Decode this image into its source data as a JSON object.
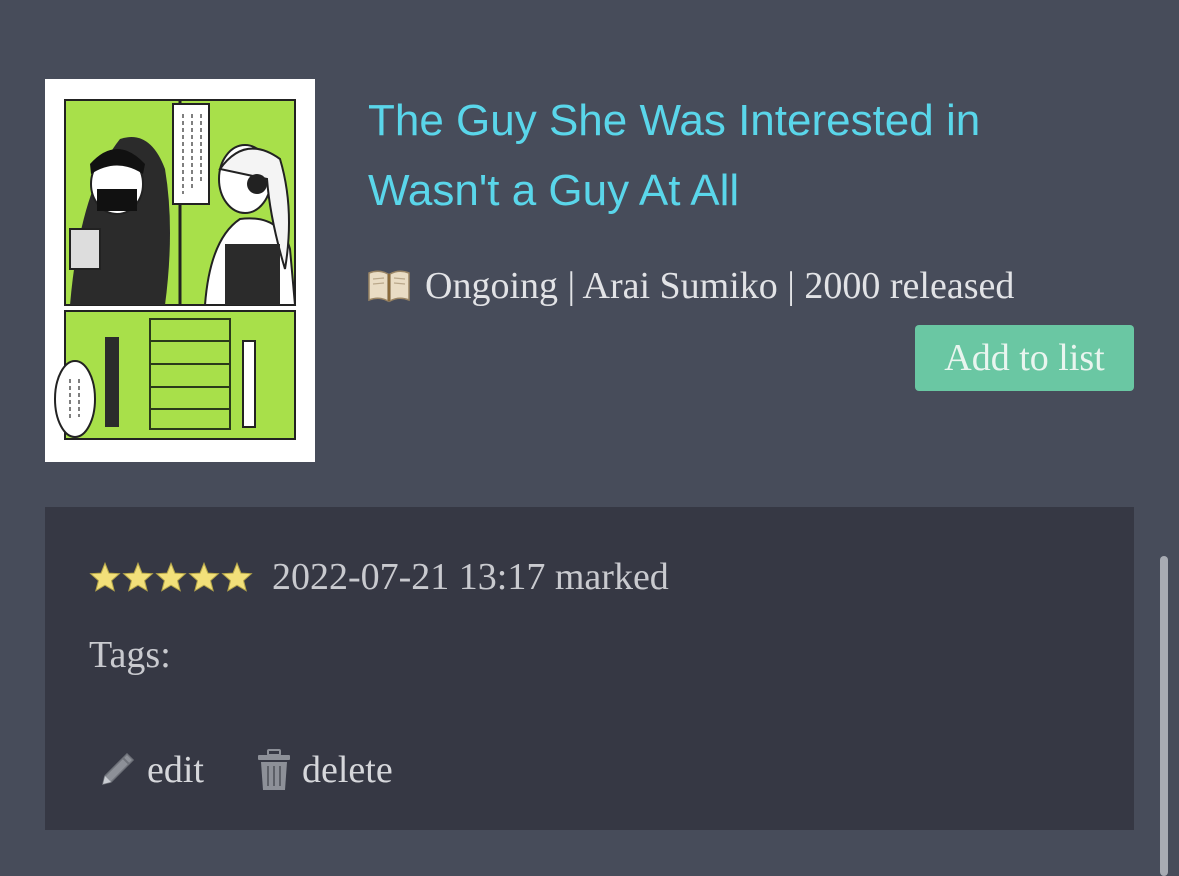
{
  "item": {
    "title": "The Guy She Was Interested in Wasn't a Guy At All",
    "status": "Ongoing",
    "author": "Arai Sumiko",
    "released": "2000 released",
    "meta_text": "Ongoing | Arai Sumiko | 2000 released",
    "add_button_label": "Add to list",
    "type_icon": "book-icon"
  },
  "mark": {
    "rating": 5,
    "rating_max": 5,
    "timestamp": "2022-07-21 13:17 marked",
    "tags_label": "Tags:",
    "edit_label": "edit",
    "delete_label": "delete"
  },
  "colors": {
    "background": "#474c5a",
    "title": "#5ad6ea",
    "button": "#6ac7a3",
    "panel": "#363844",
    "star": "#f2e07a"
  }
}
